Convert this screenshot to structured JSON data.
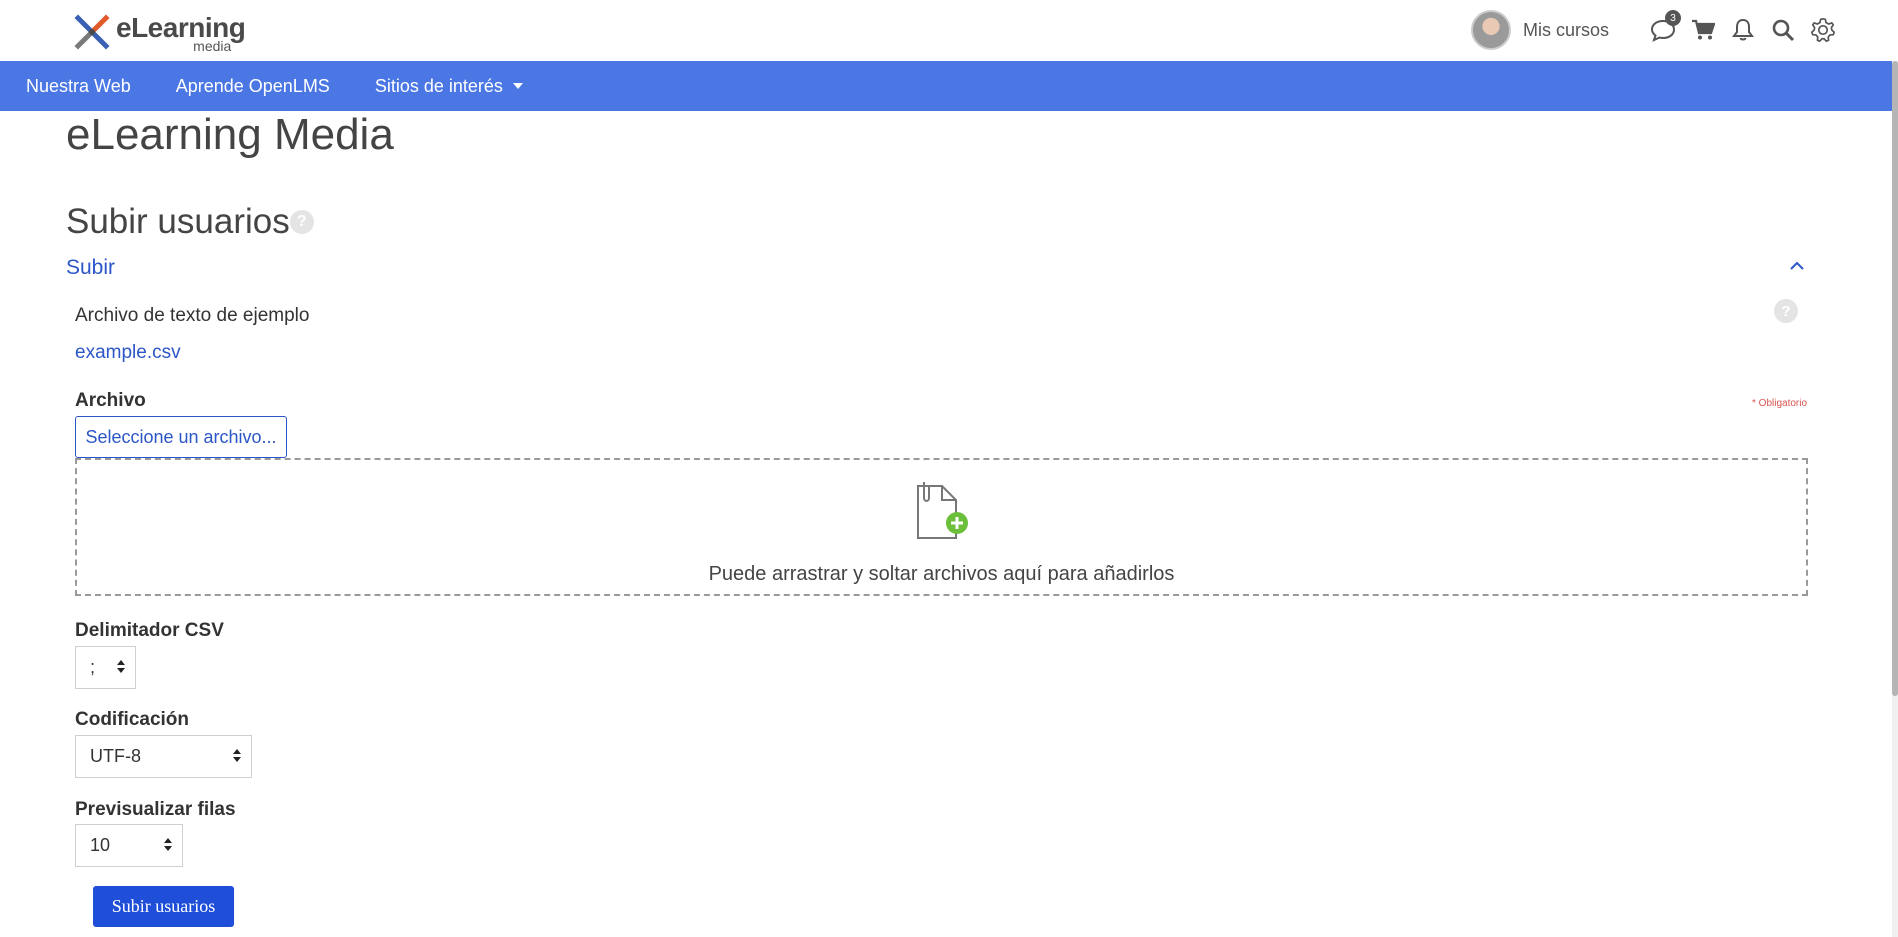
{
  "header": {
    "logo_text": "eLearning",
    "logo_sub": "media",
    "mis_cursos": "Mis cursos",
    "messages_badge": "3"
  },
  "nav": {
    "items": [
      "Nuestra Web",
      "Aprende OpenLMS",
      "Sitios de interés"
    ]
  },
  "page": {
    "site_title": "eLearning Media",
    "section_title": "Subir usuarios",
    "collapse_label": "Subir"
  },
  "form": {
    "sample_label": "Archivo de texto de ejemplo",
    "sample_link": "example.csv",
    "file_label": "Archivo",
    "required_label": "Obligatorio",
    "choose_file_button": "Seleccione un archivo...",
    "dropzone_text": "Puede arrastrar y soltar archivos aquí para añadirlos",
    "delimiter_label": "Delimitador CSV",
    "delimiter_value": ";",
    "encoding_label": "Codificación",
    "encoding_value": "UTF-8",
    "preview_label": "Previsualizar filas",
    "preview_value": "10",
    "submit_button": "Subir usuarios"
  },
  "colors": {
    "navbar": "#4a77e4",
    "link": "#2b56c7",
    "primary_button": "#1f4fd8",
    "add_icon": "#6bbf3a"
  },
  "icons": [
    "message-icon",
    "cart-icon",
    "bell-icon",
    "search-icon",
    "gear-icon",
    "help-icon",
    "chevron-up-icon",
    "file-add-icon"
  ]
}
